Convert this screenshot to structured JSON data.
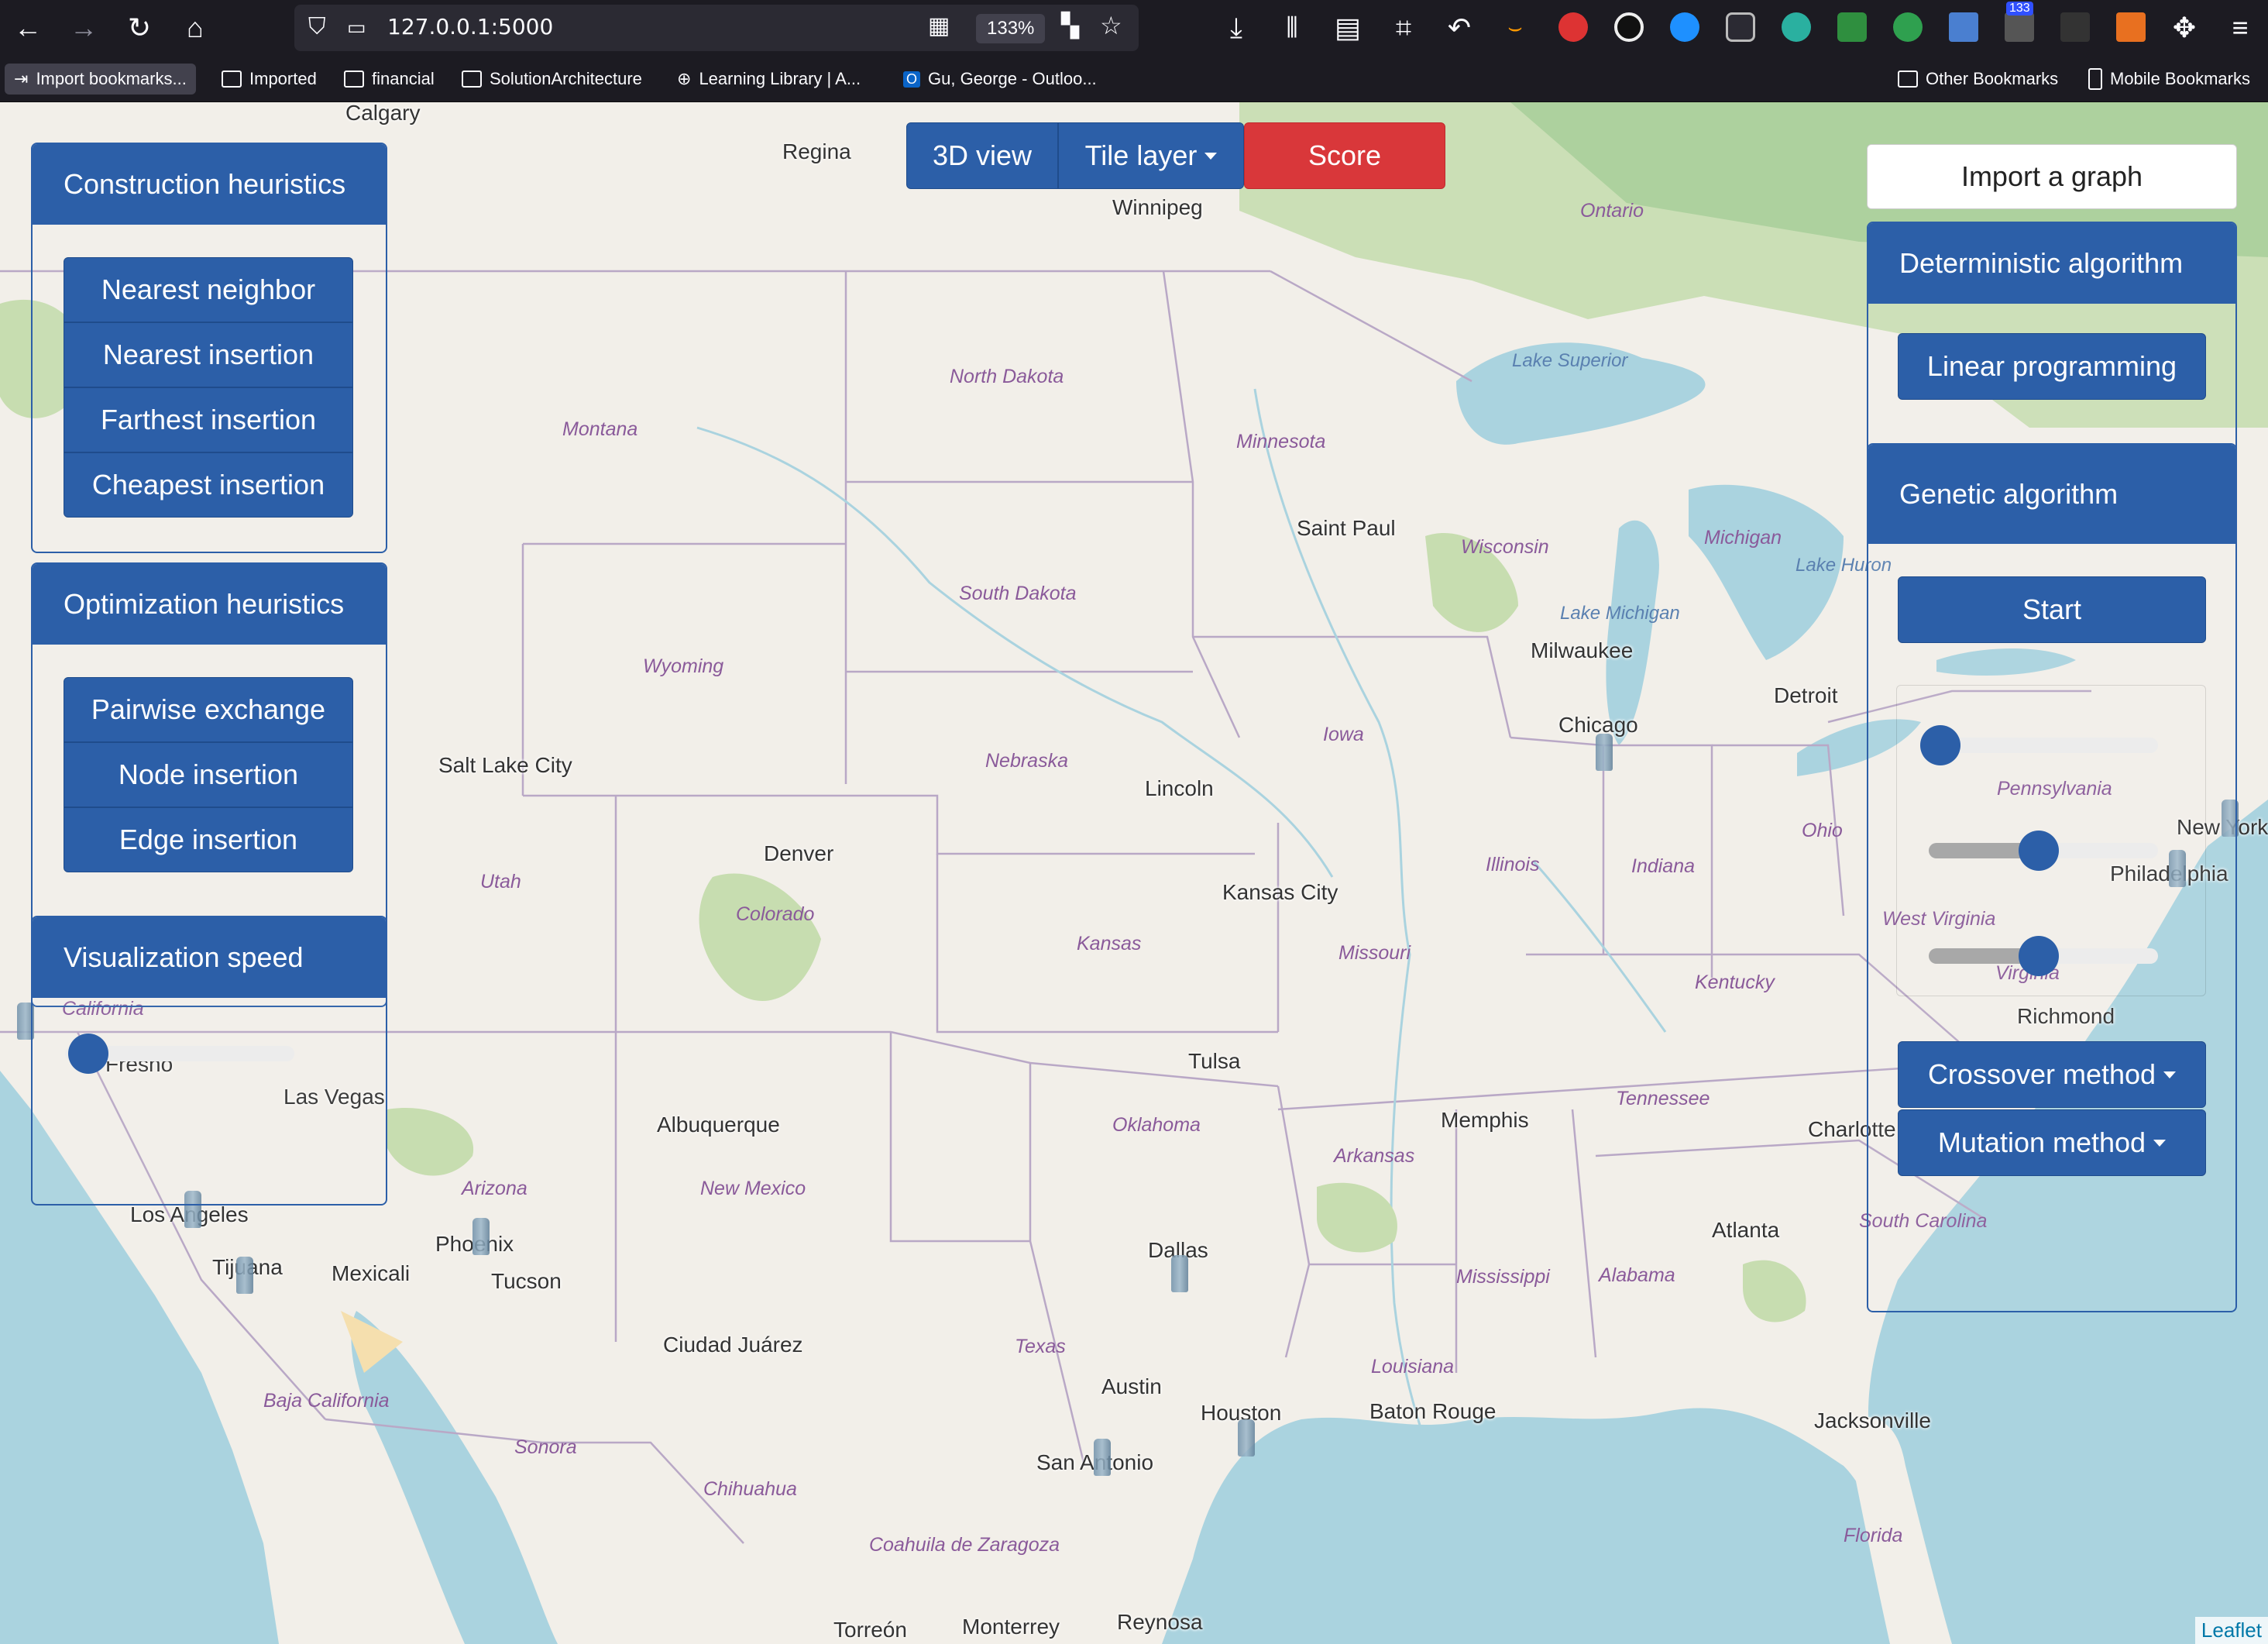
{
  "browser": {
    "url": "127.0.0.1:5000",
    "zoom": "133%",
    "notification_count": "133",
    "bookmarks": [
      "Import bookmarks...",
      "Imported",
      "financial",
      "SolutionArchitecture",
      "Learning Library | A...",
      "Gu, George - Outloo..."
    ],
    "bookmarks_right": [
      "Other Bookmarks",
      "Mobile Bookmarks"
    ]
  },
  "top_bar": {
    "view_3d": "3D view",
    "tile_layer": "Tile layer",
    "score": "Score"
  },
  "construction": {
    "title": "Construction heuristics",
    "buttons": [
      "Nearest neighbor",
      "Nearest insertion",
      "Farthest insertion",
      "Cheapest insertion"
    ]
  },
  "optimization": {
    "title": "Optimization heuristics",
    "buttons": [
      "Pairwise exchange",
      "Node insertion",
      "Edge insertion"
    ]
  },
  "visualization": {
    "title": "Visualization speed",
    "speed_value": 0.1
  },
  "right_panel": {
    "import": "Import a graph",
    "deterministic_title": "Deterministic algorithm",
    "linear_programming": "Linear programming",
    "genetic_title": "Genetic algorithm",
    "start": "Start",
    "slider_values": [
      0.05,
      0.48,
      0.48
    ],
    "crossover": "Crossover method",
    "mutation": "Mutation method"
  },
  "map": {
    "attribution": "Leaflet",
    "cities": [
      {
        "name": "Calgary"
      },
      {
        "name": "Regina"
      },
      {
        "name": "Winnipeg"
      },
      {
        "name": "Saint Paul"
      },
      {
        "name": "Milwaukee"
      },
      {
        "name": "Chicago"
      },
      {
        "name": "Detroit"
      },
      {
        "name": "Salt Lake City"
      },
      {
        "name": "Lincoln"
      },
      {
        "name": "Denver"
      },
      {
        "name": "Kansas City"
      },
      {
        "name": "Tulsa"
      },
      {
        "name": "Albuquerque"
      },
      {
        "name": "Memphis"
      },
      {
        "name": "Las Vegas"
      },
      {
        "name": "Los Angeles"
      },
      {
        "name": "Phoenix"
      },
      {
        "name": "Tijuana"
      },
      {
        "name": "Mexicali"
      },
      {
        "name": "Tucson"
      },
      {
        "name": "Dallas"
      },
      {
        "name": "Ciudad Juárez"
      },
      {
        "name": "Austin"
      },
      {
        "name": "Houston"
      },
      {
        "name": "San Antonio"
      },
      {
        "name": "Baton Rouge"
      },
      {
        "name": "Atlanta"
      },
      {
        "name": "Charlotte"
      },
      {
        "name": "Jacksonville"
      },
      {
        "name": "Richmond"
      },
      {
        "name": "New York"
      },
      {
        "name": "Philadelphia"
      },
      {
        "name": "Torreón"
      },
      {
        "name": "Monterrey"
      },
      {
        "name": "Reynosa"
      },
      {
        "name": "Fresno"
      }
    ],
    "states": [
      "Montana",
      "North Dakota",
      "Minnesota",
      "South Dakota",
      "Wisconsin",
      "Michigan",
      "Wyoming",
      "Nebraska",
      "Iowa",
      "Utah",
      "Colorado",
      "Kansas",
      "Illinois",
      "Indiana",
      "Ohio",
      "Missouri",
      "Kentucky",
      "Oklahoma",
      "Arkansas",
      "Tennessee",
      "Arizona",
      "New Mexico",
      "Texas",
      "Mississippi",
      "Alabama",
      "Louisiana",
      "California",
      "Baja California",
      "Sonora",
      "Chihuahua",
      "Coahuila de Zaragoza",
      "South Carolina",
      "Florida",
      "Pennsylvania",
      "West Virginia",
      "Virginia",
      "Ontario"
    ],
    "water": [
      "Lake Superior",
      "Lake Michigan",
      "Lake Huron"
    ]
  }
}
